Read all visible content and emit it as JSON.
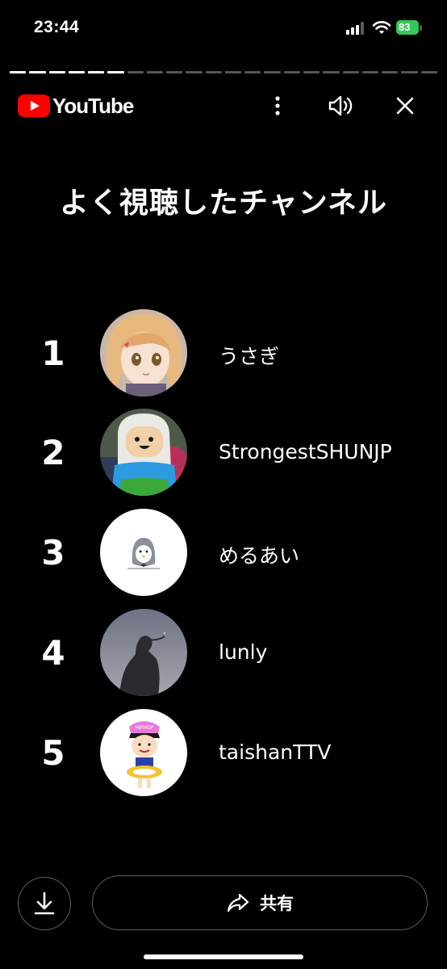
{
  "status_bar": {
    "time": "23:44",
    "battery_percent": "83",
    "battery_color": "#34c759",
    "signal_bars_active": 3,
    "signal_bars_total": 4
  },
  "story_progress": {
    "segments_total": 22,
    "segments_completed": 6
  },
  "header": {
    "logo_text": "YouTube",
    "logo_color": "#ff0000",
    "icons": [
      "more-vertical-icon",
      "volume-icon",
      "close-icon"
    ]
  },
  "main": {
    "title": "よく視聴したチャンネル",
    "channels": [
      {
        "rank": "1",
        "name": "うさぎ"
      },
      {
        "rank": "2",
        "name": "StrongestSHUNJP"
      },
      {
        "rank": "3",
        "name": "めるあい"
      },
      {
        "rank": "4",
        "name": "lunly"
      },
      {
        "rank": "5",
        "name": "taishanTTV"
      }
    ]
  },
  "avatar_art": {
    "avatar_5_cap_text": "HIPHOP"
  },
  "footer": {
    "download_icon": "download-icon",
    "share_icon": "share-arrow-icon",
    "share_label": "共有"
  }
}
